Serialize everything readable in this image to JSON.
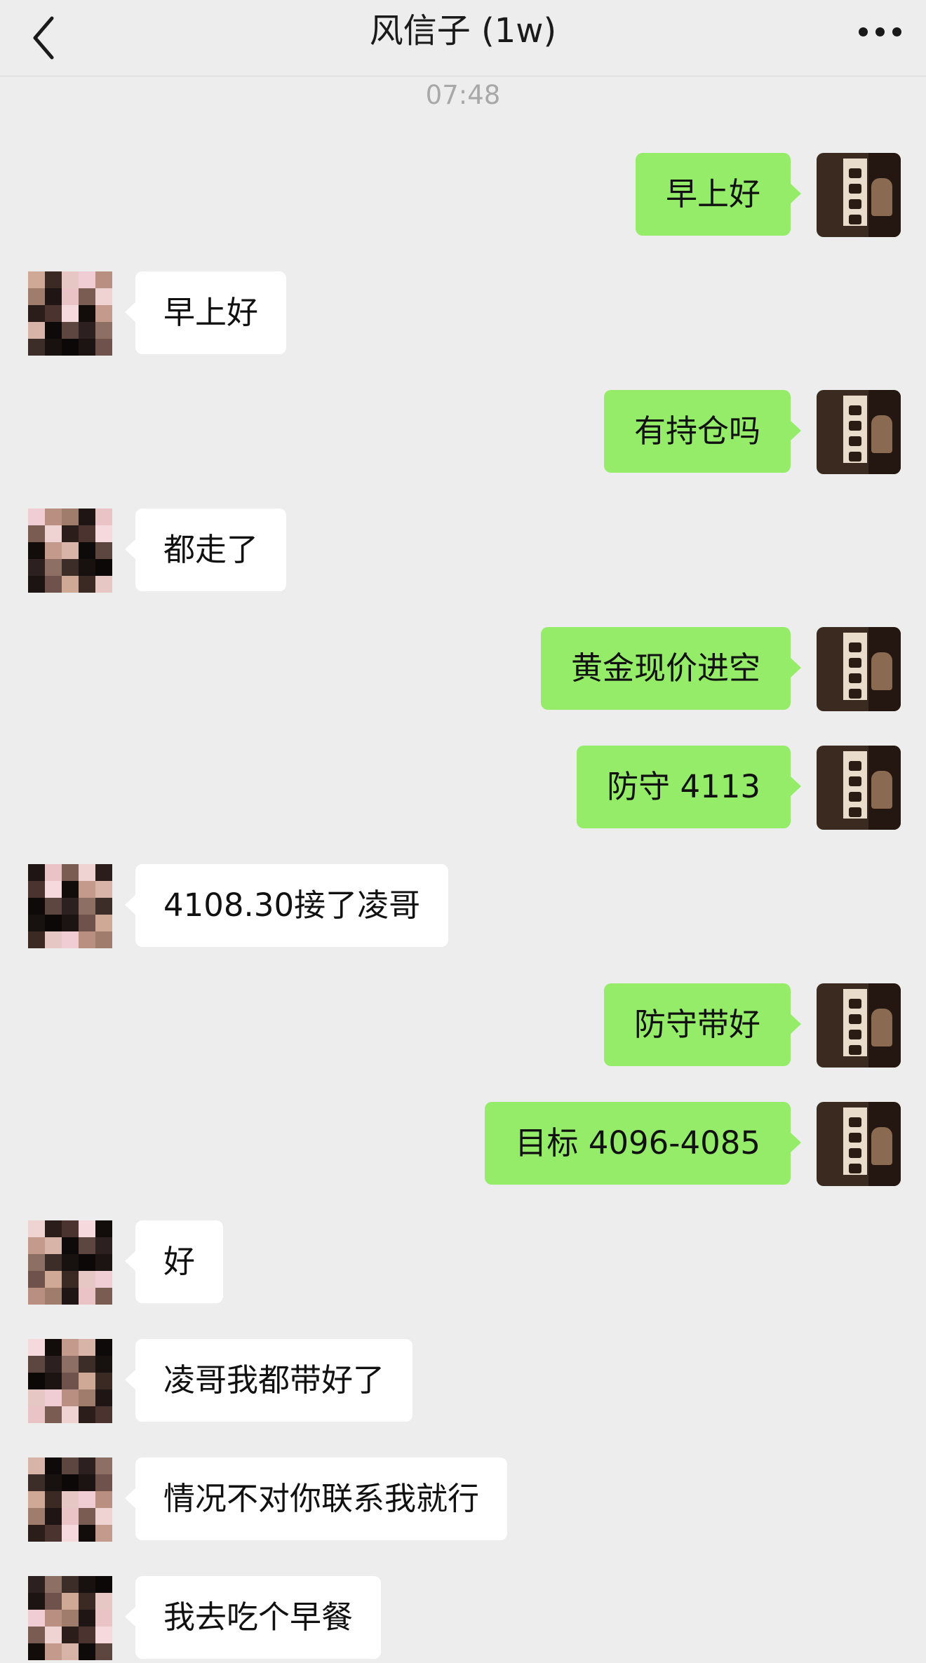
{
  "header": {
    "title": "风信子 (1w)",
    "back_icon": "chevron-left-icon",
    "more_icon": "more-dots-icon"
  },
  "timestamp": "07:48",
  "messages": [
    {
      "side": "me",
      "text": "早上好"
    },
    {
      "side": "other",
      "text": "早上好"
    },
    {
      "side": "me",
      "text": "有持仓吗"
    },
    {
      "side": "other",
      "text": "都走了"
    },
    {
      "side": "me",
      "text": "黄金现价进空"
    },
    {
      "side": "me",
      "text": "防守 4113"
    },
    {
      "side": "other",
      "text": "4108.30接了凌哥"
    },
    {
      "side": "me",
      "text": "防守带好"
    },
    {
      "side": "me",
      "text": "目标 4096-4085"
    },
    {
      "side": "other",
      "text": "好"
    },
    {
      "side": "other",
      "text": "凌哥我都带好了"
    },
    {
      "side": "other",
      "text": "情况不对你联系我就行"
    },
    {
      "side": "other",
      "text": "我去吃个早餐"
    }
  ],
  "colors": {
    "background": "#ededed",
    "me_bubble": "#95ec69",
    "other_bubble": "#ffffff"
  }
}
